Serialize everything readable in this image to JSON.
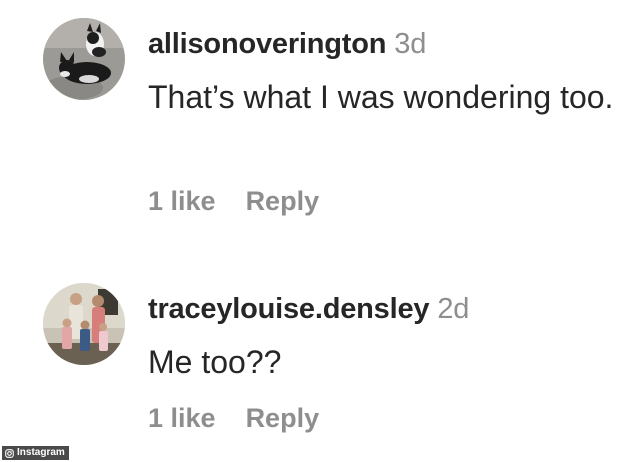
{
  "comments": [
    {
      "username": "allisonoverington",
      "timestamp": "3d",
      "text": "That’s what I was wondering too.",
      "likes": "1 like",
      "reply": "Reply",
      "avatar_icon": "profile-photo-dogs"
    },
    {
      "username": "traceylouise.densley",
      "timestamp": "2d",
      "text": "Me too??",
      "likes": "1 like",
      "reply": "Reply",
      "avatar_icon": "profile-photo-family"
    }
  ],
  "watermark": {
    "label": "Instagram",
    "icon": "instagram-icon"
  },
  "colors": {
    "text": "#262626",
    "secondary": "#8e8e8e",
    "background": "#ffffff",
    "watermark_bg": "#4a4a4a"
  }
}
